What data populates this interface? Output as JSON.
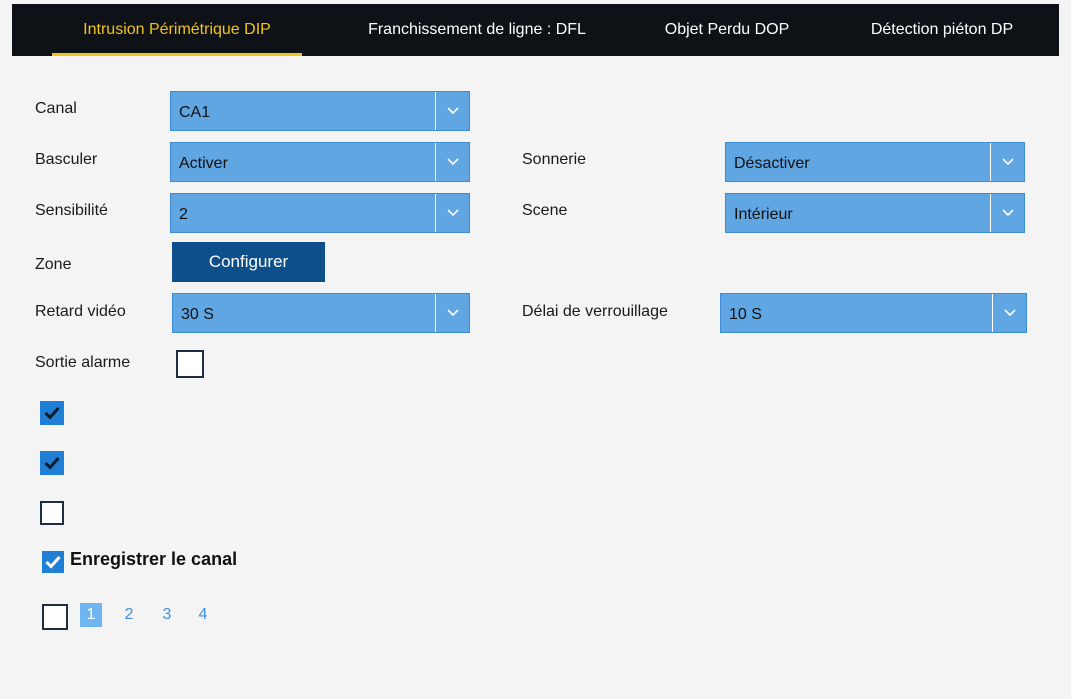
{
  "tabs": [
    {
      "label": "Intrusion Périmétrique DIP",
      "active": true
    },
    {
      "label": "Franchissement de ligne : DFL",
      "active": false
    },
    {
      "label": "Objet Perdu DOP",
      "active": false
    },
    {
      "label": "Détection piéton DP",
      "active": false
    }
  ],
  "form": {
    "canal": {
      "label": "Canal",
      "value": "CA1"
    },
    "basculer": {
      "label": "Basculer",
      "value": "Activer"
    },
    "sonnerie": {
      "label": "Sonnerie",
      "value": "Désactiver"
    },
    "sensibilite": {
      "label": "Sensibilité",
      "value": "2"
    },
    "scene": {
      "label": "Scene",
      "value": "Intérieur"
    },
    "zone": {
      "label": "Zone",
      "button": "Configurer"
    },
    "retard": {
      "label": "Retard vidéo",
      "value": "30 S"
    },
    "delai": {
      "label": "Délai de verrouillage",
      "value": "10 S"
    },
    "sortie": {
      "label": "Sortie alarme",
      "checked": false
    }
  },
  "checkboxes": [
    {
      "checked": true
    },
    {
      "checked": true
    },
    {
      "checked": false
    }
  ],
  "record": {
    "label": "Enregistrer le canal",
    "checked": true
  },
  "pagination": {
    "select_all_checked": false,
    "pages": [
      "1",
      "2",
      "3",
      "4"
    ],
    "active_page": "1"
  },
  "colors": {
    "accent_tab": "#f0c419",
    "select_bg": "#5fa6e3",
    "button_bg": "#0d4f8b",
    "checkbox_checked": "#1f7fd6"
  },
  "icons": {
    "dropdown": "chevron-down-icon",
    "check": "checkmark-icon"
  }
}
